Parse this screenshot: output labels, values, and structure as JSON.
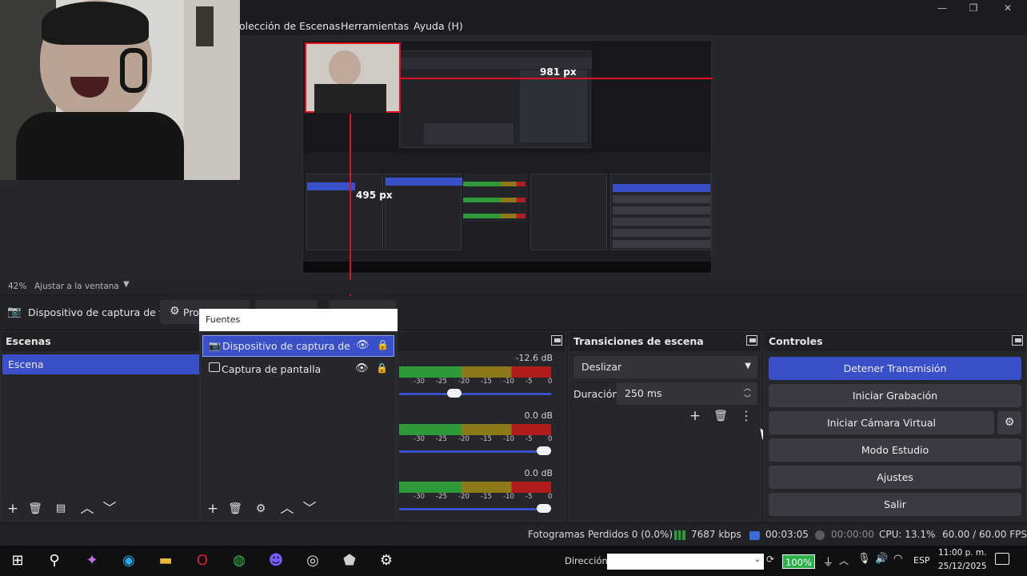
{
  "window": {
    "menu": [
      "olección de Escenas",
      "Herramientas",
      "Ayuda (H)"
    ],
    "controls": {
      "minimize": "—",
      "restore": "❐",
      "close": "✕"
    }
  },
  "preview": {
    "measure_horizontal": "981 px",
    "measure_vertical": "495 px"
  },
  "zoom": {
    "percent": "42%",
    "fit_label": "Ajustar a la ventana"
  },
  "source_toolbar": {
    "device_name": "Dispositivo de captura de v",
    "properties_label": "Pro",
    "fuentes_popup": "Fuentes"
  },
  "scenes": {
    "title": "Escenas",
    "items": [
      "Escena"
    ]
  },
  "sources": {
    "items": [
      "Dispositivo de captura de vídeo",
      "Captura de pantalla"
    ]
  },
  "mixer": {
    "channels": [
      {
        "db": "-12.6 dB",
        "volume": 0.35
      },
      {
        "db": "0.0 dB",
        "volume": 1.0
      },
      {
        "db": "0.0 dB",
        "volume": 1.0
      }
    ],
    "scale": [
      "-30",
      "-25",
      "-20",
      "-15",
      "-10",
      "-5",
      "0"
    ]
  },
  "transitions": {
    "title": "Transiciones de escena",
    "selected": "Deslizar",
    "duration_label": "Duración",
    "duration_value": "250 ms"
  },
  "controls": {
    "title": "Controles",
    "buttons": [
      "Detener Transmisión",
      "Iniciar Grabación",
      "Iniciar Cámara Virtual",
      "Modo Estudio",
      "Ajustes",
      "Salir"
    ]
  },
  "status": {
    "dropped": "Fotogramas Perdidos 0 (0.0%)",
    "bitrate": "7687 kbps",
    "stream_time": "00:03:05",
    "rec_time": "00:00:00",
    "cpu": "CPU: 13.1%",
    "fps": "60.00 / 60.00 FPS"
  },
  "taskbar": {
    "address_label": "Dirección",
    "battery": "100%",
    "lang": "ESP",
    "time": "11:00 p. m.",
    "date": "25/12/2025"
  },
  "colors": {
    "accent": "#3a50c8",
    "measure": "#e01020",
    "meter_green": "#2e9a3a",
    "meter_yellow": "#8c7a1a",
    "meter_red": "#b21c1c"
  }
}
